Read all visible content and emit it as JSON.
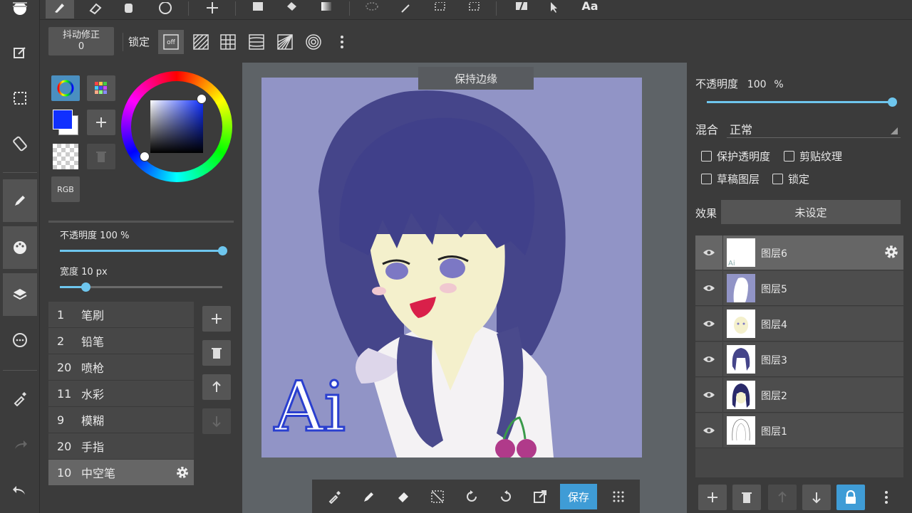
{
  "stabilizer": {
    "label": "抖动修正",
    "value": "0"
  },
  "snap": {
    "label": "锁定",
    "off_label": "off"
  },
  "color_panel": {
    "rgb_label": "RGB",
    "primary_color": "#1030ff",
    "hue_ring": true
  },
  "brush_opacity": {
    "label": "不透明度 100 %",
    "value": 100
  },
  "brush_width": {
    "label": "宽度 10 px",
    "value": 10,
    "max_fraction": 0.16
  },
  "brushes": [
    {
      "num": "1",
      "name": "笔刷"
    },
    {
      "num": "2",
      "name": "铅笔"
    },
    {
      "num": "20",
      "name": "喷枪"
    },
    {
      "num": "11",
      "name": "水彩"
    },
    {
      "num": "9",
      "name": "模糊"
    },
    {
      "num": "20",
      "name": "手指"
    },
    {
      "num": "10",
      "name": "中空笔"
    }
  ],
  "canvas": {
    "toast": "保持边缘",
    "signature": "Ai",
    "background": "#9194c6"
  },
  "bottom_bar": {
    "save_label": "保存"
  },
  "layer_props": {
    "opacity_label": "不透明度",
    "opacity_value": "100",
    "opacity_unit": "%",
    "blend_label": "混合",
    "blend_value": "正常",
    "protect_alpha": "保护透明度",
    "clipping": "剪贴纹理",
    "draft": "草稿图层",
    "lock": "锁定",
    "effect_label": "效果",
    "effect_value": "未设定"
  },
  "layers": [
    {
      "name": "图层6",
      "selected": true
    },
    {
      "name": "图层5",
      "selected": false
    },
    {
      "name": "图层4",
      "selected": false
    },
    {
      "name": "图层3",
      "selected": false
    },
    {
      "name": "图层2",
      "selected": false
    },
    {
      "name": "图层1",
      "selected": false
    }
  ],
  "colors": {
    "accent": "#6ec6ee",
    "save_blue": "#3f9cd6"
  },
  "topbar_text": {
    "text_tool": "Aa"
  }
}
